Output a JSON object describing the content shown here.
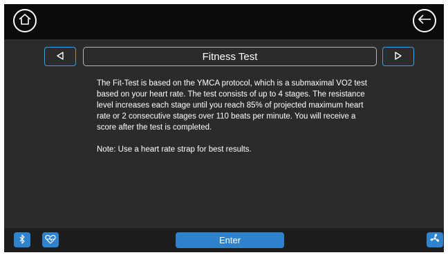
{
  "header": {
    "home_icon": "home-icon",
    "back_icon": "arrow-left-icon"
  },
  "navigation": {
    "prev_icon": "triangle-left-icon",
    "next_icon": "triangle-right-icon",
    "title": "Fitness Test"
  },
  "content": {
    "description": "The Fit-Test is based on the YMCA protocol, which is a submaximal VO2 test based on your heart rate. The test consists of up to 4 stages. The resistance level increases each stage until you reach 85% of projected maximum heart rate or 2 consecutive stages over 110 beats per minute. You will receive a score after the test is completed.",
    "note": "Note: Use a heart rate strap for best results."
  },
  "footer": {
    "bluetooth_icon": "bluetooth-icon",
    "heart_rate_icon": "heart-rate-icon",
    "enter_label": "Enter",
    "fan_icon": "fan-icon"
  },
  "colors": {
    "accent": "#2f82cc",
    "outline_accent": "#3aa0e0",
    "background": "#2b2b2b",
    "topbar": "#0b0b0b"
  }
}
